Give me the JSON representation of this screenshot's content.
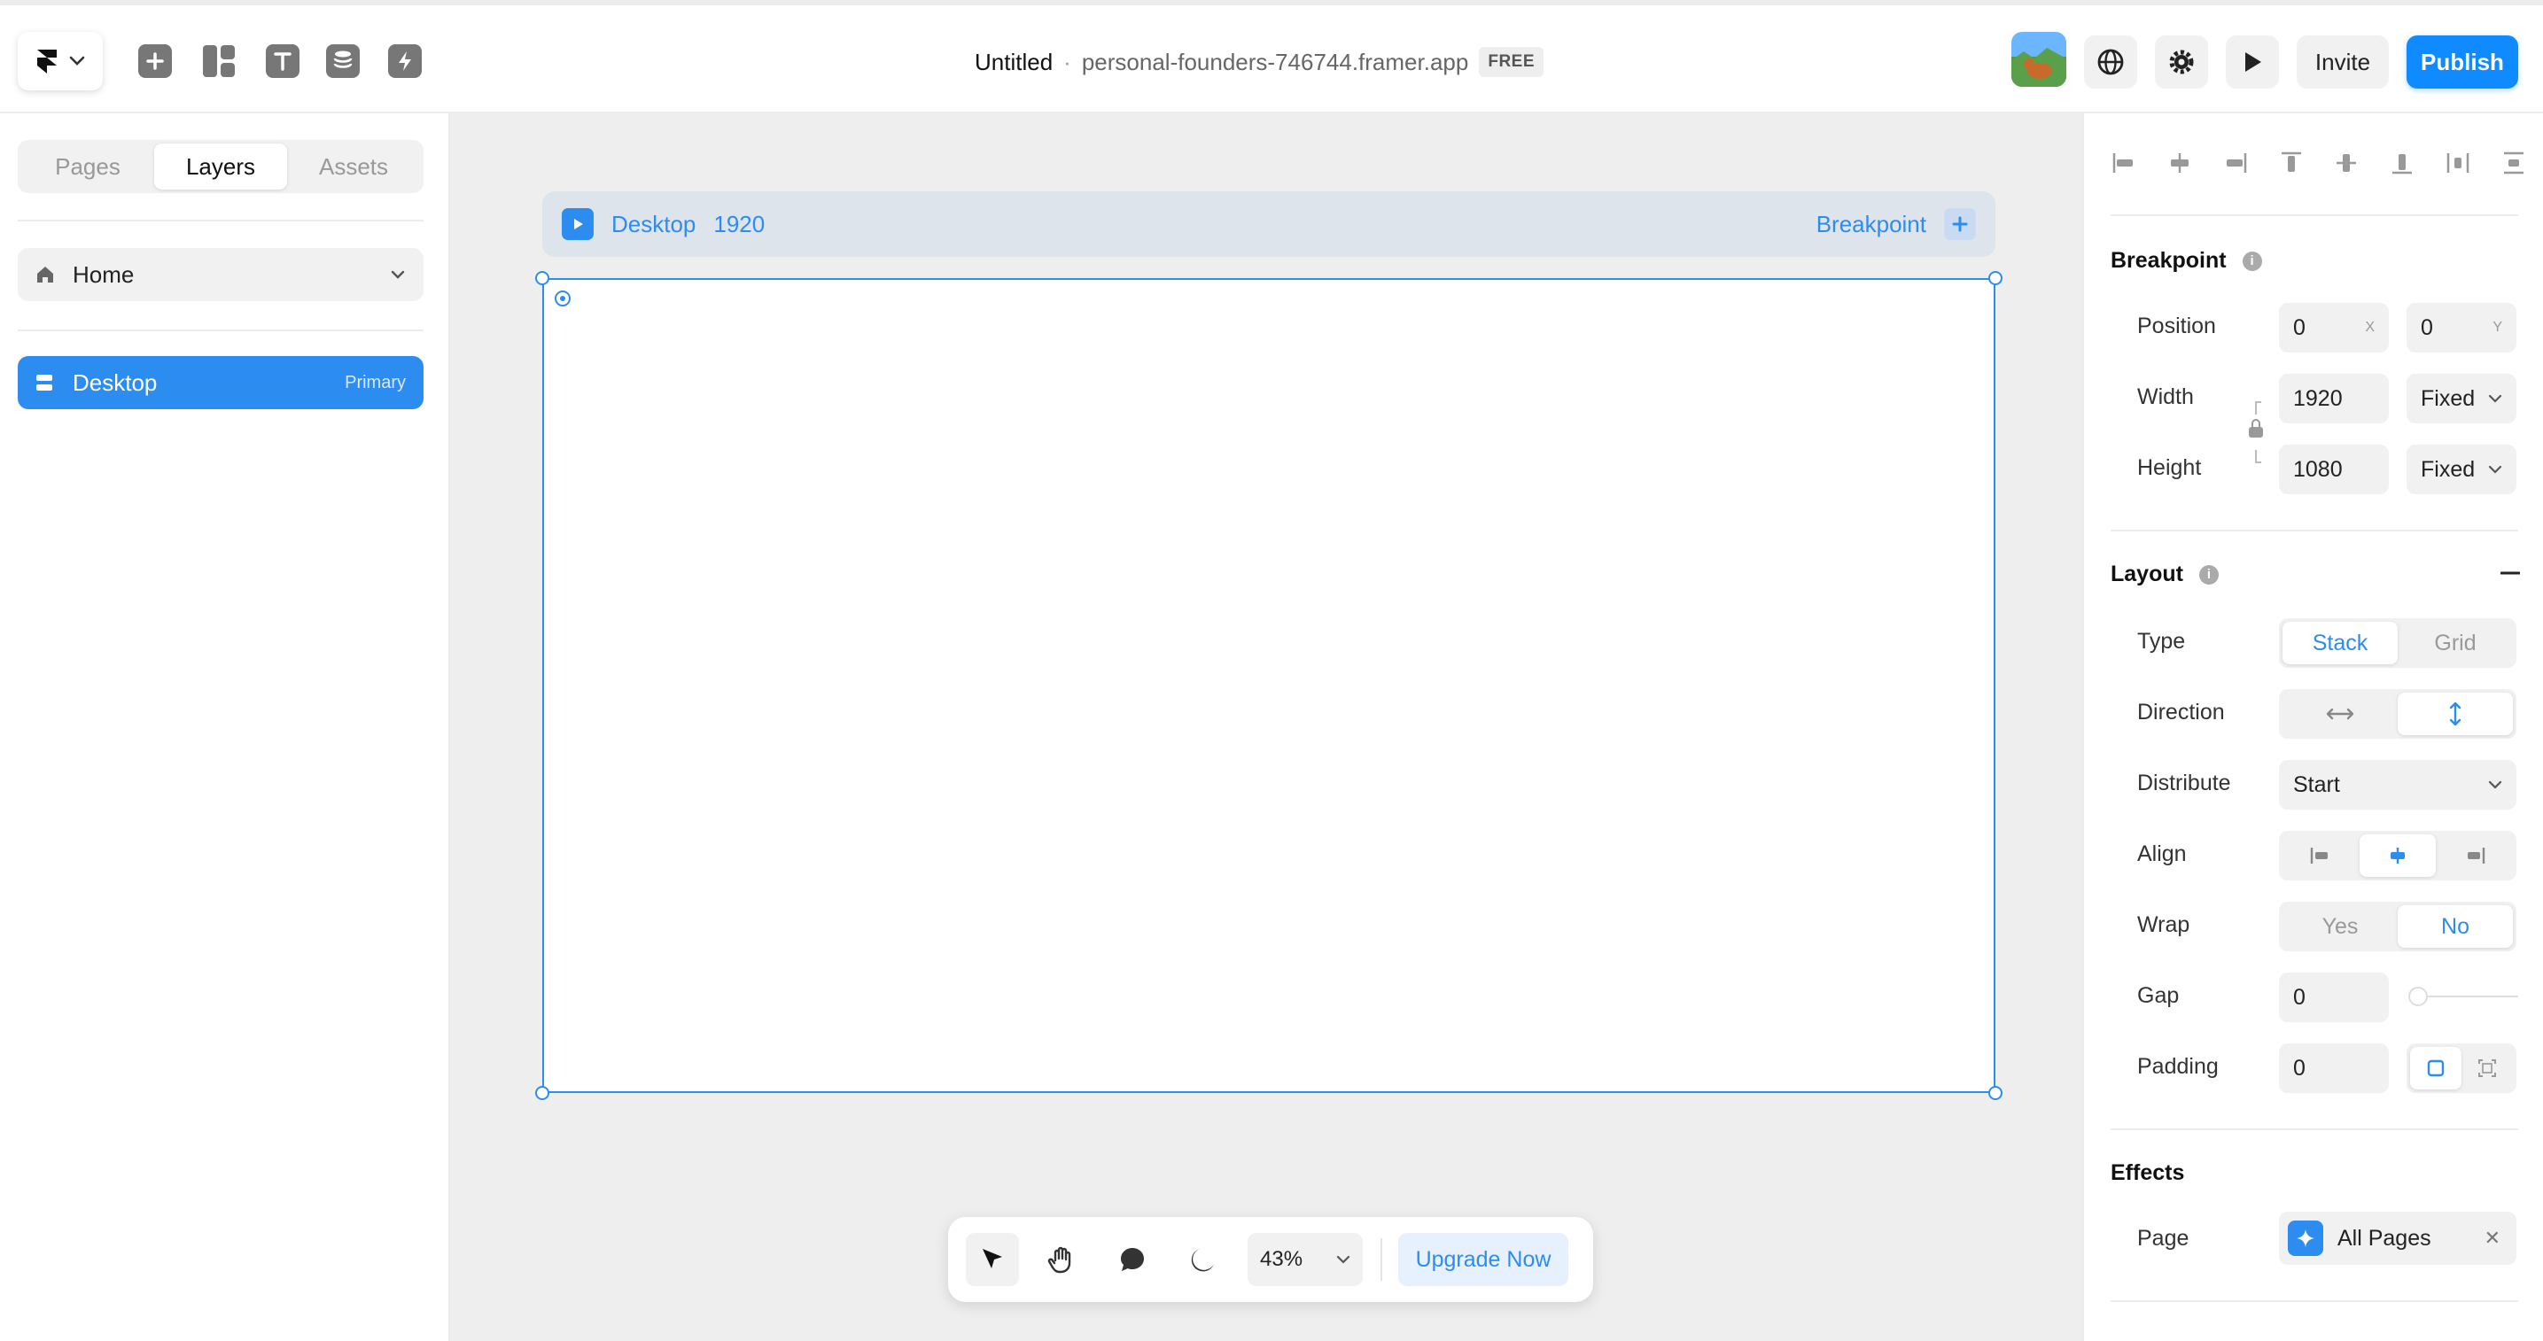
{
  "topbar": {
    "project_title": "Untitled",
    "separator": "·",
    "domain": "personal-founders-746744.framer.app",
    "plan_badge": "FREE",
    "invite_label": "Invite",
    "publish_label": "Publish"
  },
  "sidebar": {
    "tabs": [
      "Pages",
      "Layers",
      "Assets"
    ],
    "active_tab": "Layers",
    "page_select": "Home",
    "layers": [
      {
        "label": "Desktop",
        "tag": "Primary"
      }
    ]
  },
  "canvas": {
    "breakpoint_bar": {
      "name": "Desktop",
      "width": "1920",
      "action_label": "Breakpoint"
    }
  },
  "toolbar": {
    "zoom": "43%",
    "upgrade_label": "Upgrade Now"
  },
  "panel": {
    "breakpoint": {
      "title": "Breakpoint",
      "position_label": "Position",
      "position_x": "0",
      "position_y": "0",
      "x_axis": "X",
      "y_axis": "Y",
      "width_label": "Width",
      "width_value": "1920",
      "width_mode": "Fixed",
      "height_label": "Height",
      "height_value": "1080",
      "height_mode": "Fixed"
    },
    "layout": {
      "title": "Layout",
      "type_label": "Type",
      "type_options": [
        "Stack",
        "Grid"
      ],
      "type_selected": "Stack",
      "direction_label": "Direction",
      "distribute_label": "Distribute",
      "distribute_value": "Start",
      "align_label": "Align",
      "wrap_label": "Wrap",
      "wrap_options": [
        "Yes",
        "No"
      ],
      "wrap_selected": "No",
      "gap_label": "Gap",
      "gap_value": "0",
      "padding_label": "Padding",
      "padding_value": "0"
    },
    "effects": {
      "title": "Effects",
      "page_label": "Page",
      "page_value": "All Pages"
    }
  },
  "colors": {
    "accent": "#2d8cf0",
    "publish": "#0f8bff",
    "canvas_bg": "#eeeeee"
  }
}
